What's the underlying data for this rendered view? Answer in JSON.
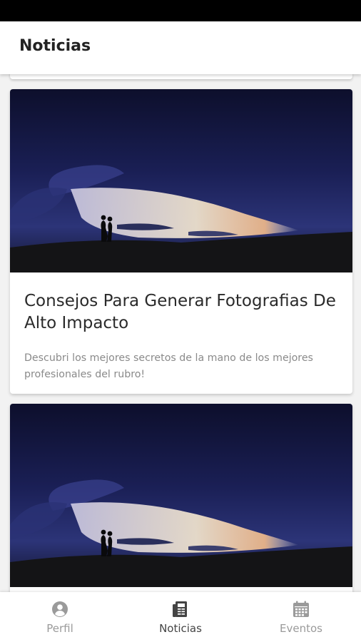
{
  "header": {
    "title": "Noticias"
  },
  "news": [
    {
      "image": "couple-silhouette-stormy-sunset-photo",
      "title": "Consejos Para Generar Fotografias De Alto Impacto",
      "description": "Descubri los mejores secretos de la mano de los mejores profesionales del rubro!"
    },
    {
      "image": "couple-silhouette-stormy-sunset-photo"
    }
  ],
  "nav": {
    "items": [
      {
        "label": "Perfil",
        "icon": "user-circle-icon",
        "active": false
      },
      {
        "label": "Noticias",
        "icon": "newspaper-icon",
        "active": true
      },
      {
        "label": "Eventos",
        "icon": "calendar-icon",
        "active": false
      }
    ]
  },
  "colors": {
    "active_nav": "#444444",
    "inactive_nav": "#9a9a9a",
    "title_text": "#222222",
    "sky_dark": "#15183a"
  }
}
